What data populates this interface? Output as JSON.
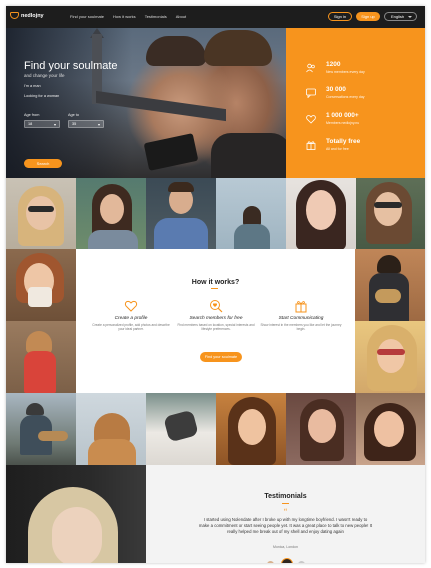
{
  "brand": {
    "name": "nedlojny",
    "accent": "#f7941d",
    "dark": "#1d1d1d"
  },
  "nav": {
    "links": [
      "Find your soulmate",
      "How it works",
      "Testimonials",
      "About"
    ],
    "signin": "Sign in",
    "signup": "Sign up",
    "language": "English"
  },
  "hero": {
    "title": "Find your soulmate",
    "subtitle": "and change your life",
    "gender_value": "I'm a man",
    "looking_value": "Looking for a woman",
    "age_from_label": "Age from",
    "age_from_value": "18",
    "age_to_label": "Age to",
    "age_to_value": "35",
    "search_label": "Search"
  },
  "stats": [
    {
      "number": "1200",
      "label": "New members every day",
      "icon": "users-icon"
    },
    {
      "number": "30 000",
      "label": "Conversations every day",
      "icon": "chat-icon"
    },
    {
      "number": "1 000 000+",
      "label": "Members nedlojny.nu",
      "icon": "heart-icon"
    },
    {
      "number": "Totally free",
      "label": "All and for free",
      "icon": "gift-icon"
    }
  ],
  "how": {
    "title": "How it works?",
    "steps": [
      {
        "title": "Create a profile",
        "desc": "Create a personalized profile, add photos and describe your ideal partner.",
        "icon": "heart-outline-icon"
      },
      {
        "title": "Search members for free",
        "desc": "Find members based on location, special interests and lifestyle preferences.",
        "icon": "search-heart-icon"
      },
      {
        "title": "Start Communicating",
        "desc": "Show interest in the members you like and let the journey begin.",
        "icon": "gift-box-icon"
      }
    ],
    "button": "Find your soulmate"
  },
  "testimonials": {
    "title": "Testimonials",
    "quote_mark": "“",
    "text": "I started using Nolendate after I broke up with my longtime boyfriend. I wasn't ready to make a commitment or start seeing people yet. It was a great place to talk to new people! It really helped me break out of my shell and enjoy dating again",
    "author": "Monica, London"
  }
}
